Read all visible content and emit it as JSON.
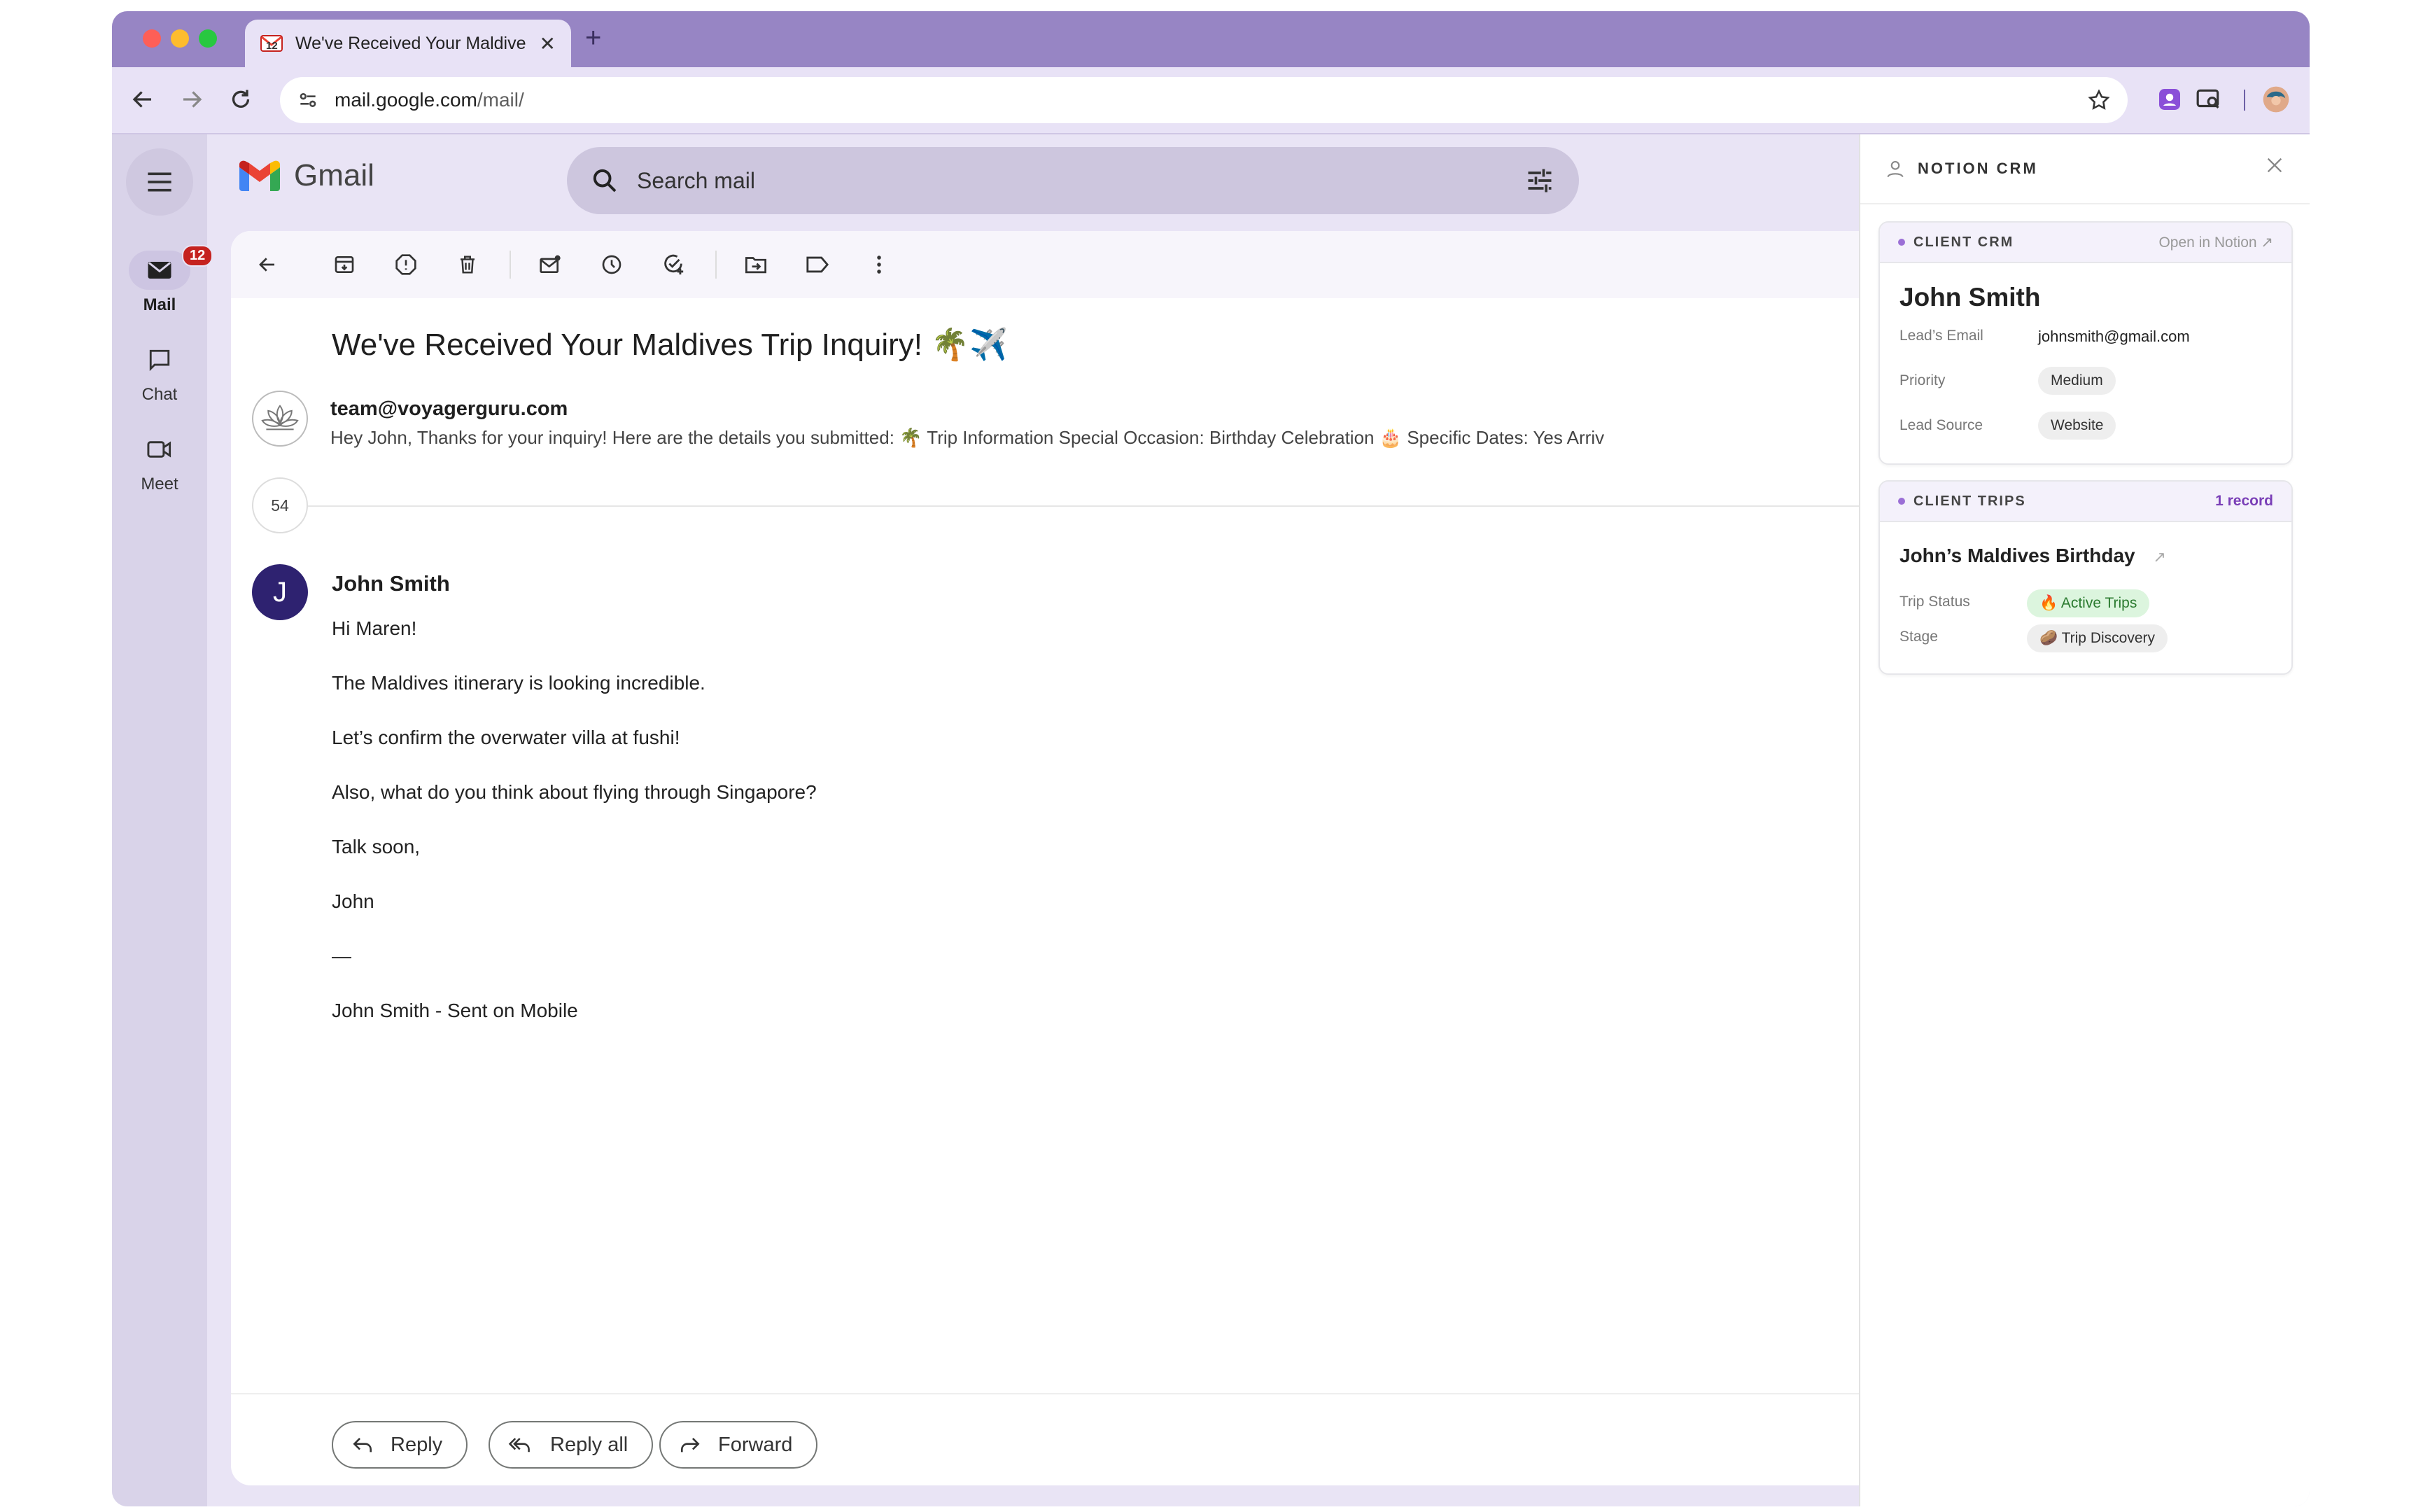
{
  "browser": {
    "tab_title": "We've Received Your Maldive",
    "tab_favicon_count": "12",
    "url_host": "mail.google.com",
    "url_path": "/mail/"
  },
  "gmail": {
    "app_name": "Gmail",
    "search_placeholder": "Search mail",
    "rail": [
      {
        "label": "Mail",
        "badge": "12"
      },
      {
        "label": "Chat"
      },
      {
        "label": "Meet"
      }
    ],
    "thread": {
      "subject": "We've Received Your Maldives Trip Inquiry! 🌴✈️",
      "first_sender": "team@voyagerguru.com",
      "first_snippet": "Hey John, Thanks for your inquiry! Here are the details you submitted: 🌴 Trip Information Special Occasion: Birthday Celebration 🎂 Specific Dates: Yes Arriv",
      "collapsed_count": "54",
      "last_sender_initial": "J",
      "last_sender": "John Smith",
      "body_lines": [
        "Hi Maren!",
        "The Maldives itinerary is looking incredible.",
        "Let’s confirm the overwater villa at fushi!",
        "Also, what do you think about flying through Singapore?",
        "Talk soon,",
        "John",
        "—",
        "John Smith - Sent on Mobile"
      ]
    },
    "actions": {
      "reply": "Reply",
      "reply_all": "Reply all",
      "forward": "Forward"
    }
  },
  "crm": {
    "panel_title": "NOTION CRM",
    "client_card": {
      "header": "CLIENT CRM",
      "open_link": "Open in Notion ↗",
      "name": "John Smith",
      "fields": [
        {
          "label": "Lead’s Email",
          "value": "johnsmith@gmail.com"
        },
        {
          "label": "Priority",
          "value": "Medium"
        },
        {
          "label": "Lead Source",
          "value": "Website"
        }
      ]
    },
    "trips_card": {
      "header": "CLIENT TRIPS",
      "record_count": "1 record",
      "trip_name": "John’s Maldives Birthday",
      "trip_link_icon": "↗",
      "fields": [
        {
          "label": "Trip Status",
          "value": "🔥 Active Trips"
        },
        {
          "label": "Stage",
          "value": "🥔 Trip Discovery"
        }
      ]
    }
  },
  "colors": {
    "tabstrip": "#9785c4",
    "toolbar": "#e8e2f6",
    "avatar": "#2e2270",
    "badge": "#c5221f",
    "accent_purple": "#9b6fd6"
  }
}
